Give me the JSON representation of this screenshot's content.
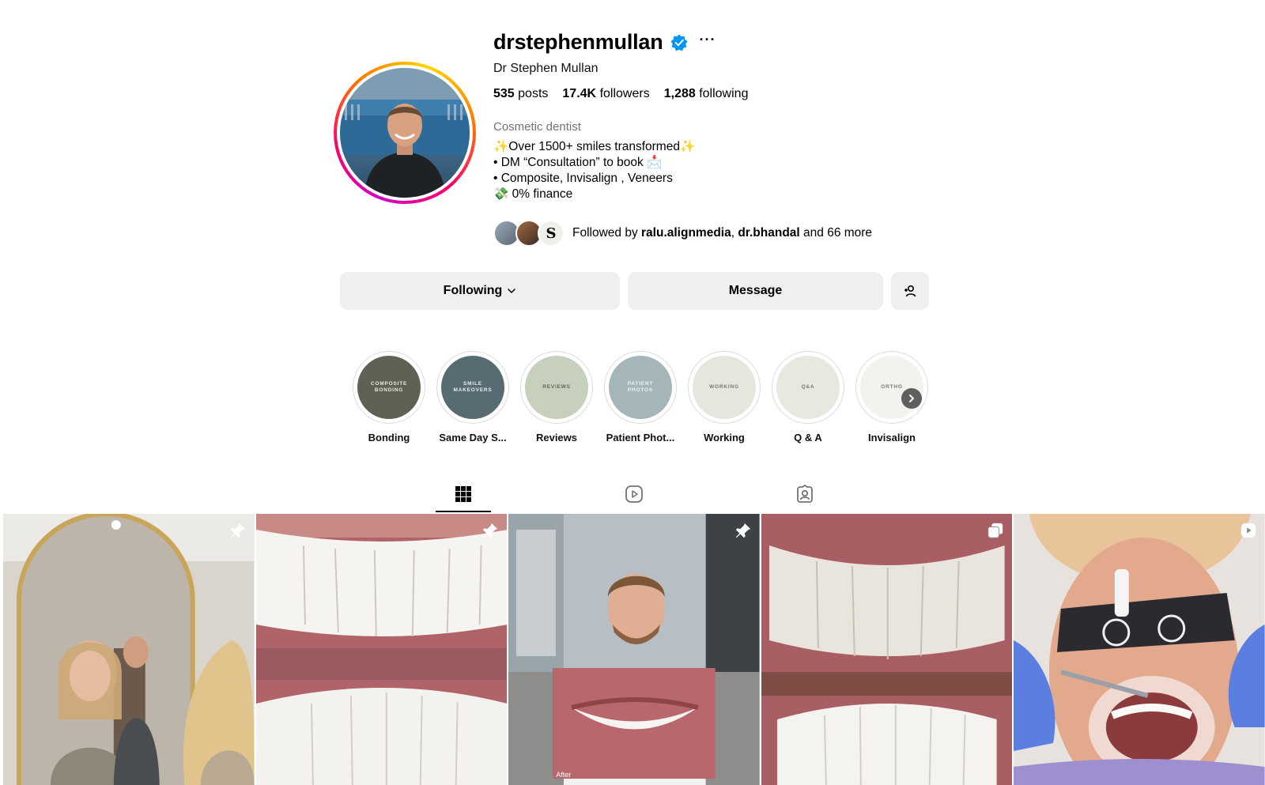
{
  "profile": {
    "username": "drstephenmullan",
    "verified": true,
    "full_name": "Dr Stephen Mullan",
    "stats": {
      "posts_count": "535",
      "posts_label": "posts",
      "followers_count": "17.4K",
      "followers_label": "followers",
      "following_count": "1,288",
      "following_label": "following"
    },
    "category": "Cosmetic dentist",
    "bio_lines": [
      "✨Over 1500+ smiles transformed✨",
      "• DM “Consultation” to book 📩",
      "• Composite, Invisalign , Veneers",
      "💸 0% finance"
    ],
    "followed_by": {
      "prefix": "Followed by ",
      "user1": "ralu.alignmedia",
      "separator": ", ",
      "user2": "dr.bhandal",
      "suffix": " and 66 more"
    }
  },
  "actions": {
    "following_label": "Following",
    "message_label": "Message",
    "more_label": "···"
  },
  "highlights": [
    {
      "label": "Bonding",
      "cover_text_top": "COMPOSITE",
      "cover_text_bottom": "BONDING",
      "color": "#5e6153",
      "text_color": "#e9e7df"
    },
    {
      "label": "Same Day S...",
      "cover_text_top": "SMILE",
      "cover_text_bottom": "MAKEOVERS",
      "color": "#566b72",
      "text_color": "#e8eef0"
    },
    {
      "label": "Reviews",
      "cover_text_top": "REVIEWS",
      "cover_text_bottom": "",
      "color": "#c6d0bd",
      "text_color": "#5f6658"
    },
    {
      "label": "Patient Phot...",
      "cover_text_top": "PATIENT",
      "cover_text_bottom": "PHOTOS",
      "color": "#a5b6b9",
      "text_color": "#eef2f2"
    },
    {
      "label": "Working",
      "cover_text_top": "WORKING",
      "cover_text_bottom": "",
      "color": "#e7e6dc",
      "text_color": "#77776f"
    },
    {
      "label": "Q & A",
      "cover_text_top": "Q&A",
      "cover_text_bottom": "",
      "color": "#e8e7e0",
      "text_color": "#77776f"
    },
    {
      "label": "Invisalign",
      "cover_text_top": "ORTHO",
      "cover_text_bottom": "",
      "color": "#f3f2ee",
      "text_color": "#77776f"
    }
  ],
  "tabs": [
    {
      "name": "posts",
      "icon": "grid-icon",
      "active": true
    },
    {
      "name": "reels",
      "icon": "reels-icon",
      "active": false
    },
    {
      "name": "tagged",
      "icon": "tagged-icon",
      "active": false
    }
  ],
  "posts": [
    {
      "badge": "pin-icon",
      "overlay_text": ""
    },
    {
      "badge": "pin-icon",
      "overlay_text": ""
    },
    {
      "badge": "pin-icon",
      "overlay_text": "After"
    },
    {
      "badge": "carousel-icon",
      "overlay_text": ""
    },
    {
      "badge": "reel-icon",
      "overlay_text": ""
    }
  ],
  "colors": {
    "button_bg": "#efefef",
    "verified_blue": "#0095f6",
    "secondary_text": "#737373"
  }
}
